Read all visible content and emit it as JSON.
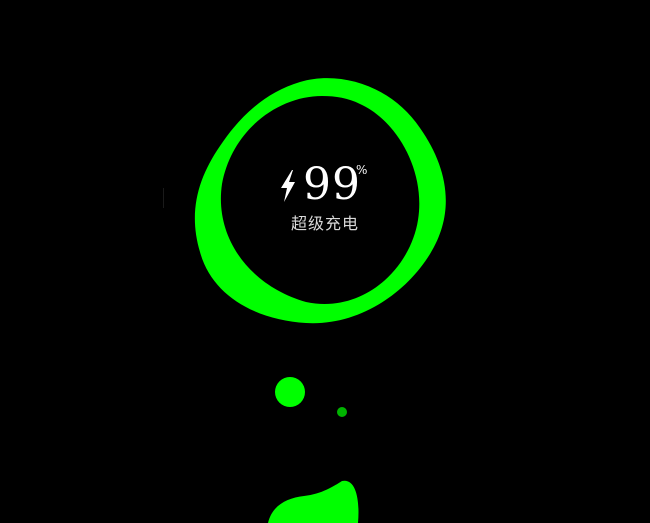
{
  "charge": {
    "value": "99",
    "unit": "%",
    "label": "超级充电"
  },
  "icons": {
    "charging": "lightning-bolt-icon"
  },
  "colors": {
    "background": "#000000",
    "accent": "#00ff00",
    "text": "#ffffff",
    "label": "#d9d9d9"
  }
}
